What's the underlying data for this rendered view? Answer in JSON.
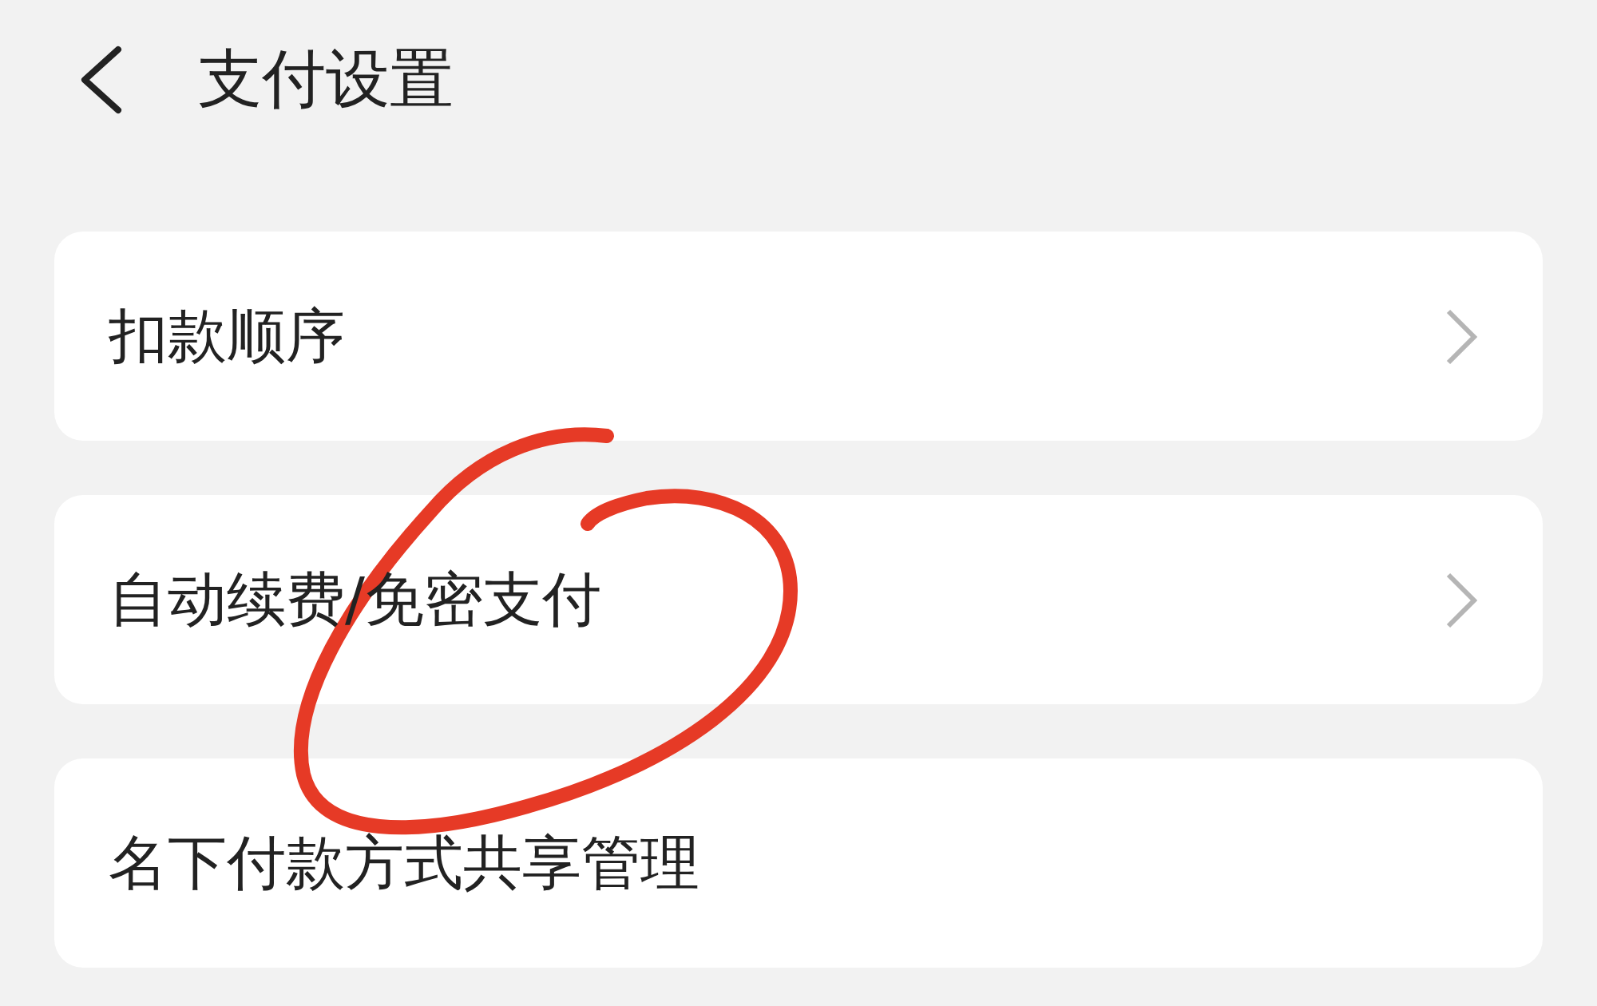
{
  "header": {
    "title": "支付设置"
  },
  "items": [
    {
      "label": "扣款顺序",
      "chevron": true
    },
    {
      "label": "自动续费/免密支付",
      "chevron": true
    },
    {
      "label": "名下付款方式共享管理",
      "chevron": false
    }
  ]
}
